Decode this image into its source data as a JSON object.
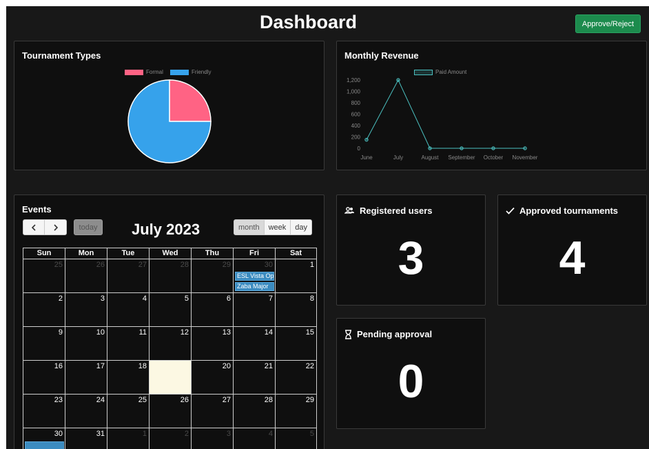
{
  "header": {
    "title": "Dashboard",
    "approve_label": "Approve/Reject"
  },
  "tournament_types": {
    "title": "Tournament Types",
    "legend": [
      {
        "label": "Formal",
        "color": "#ff6384"
      },
      {
        "label": "Friendly",
        "color": "#36a2eb"
      }
    ]
  },
  "monthly_revenue": {
    "title": "Monthly Revenue",
    "legend_label": "Paid Amount"
  },
  "chart_data": [
    {
      "type": "pie",
      "labels": [
        "Formal",
        "Friendly"
      ],
      "values": [
        1,
        3
      ],
      "colors": [
        "#ff6384",
        "#36a2eb"
      ],
      "legend": "top"
    },
    {
      "type": "line",
      "x": [
        "June",
        "July",
        "August",
        "September",
        "October",
        "November"
      ],
      "series": [
        {
          "name": "Paid Amount",
          "values": [
            150,
            1200,
            0,
            0,
            0,
            0
          ],
          "color": "#4bc0c0"
        }
      ],
      "ylim": [
        0,
        1200
      ],
      "yticks": [
        "1,200",
        "1,000",
        "800",
        "600",
        "400",
        "200",
        "0"
      ],
      "legend": "top"
    }
  ],
  "events": {
    "title": "Events",
    "today_label": "today",
    "month_title": "July 2023",
    "views": [
      "month",
      "week",
      "day"
    ],
    "weekdays": [
      "Sun",
      "Mon",
      "Tue",
      "Wed",
      "Thu",
      "Fri",
      "Sat"
    ],
    "weeks": [
      [
        {
          "d": "25",
          "o": true
        },
        {
          "d": "26",
          "o": true
        },
        {
          "d": "27",
          "o": true
        },
        {
          "d": "28",
          "o": true
        },
        {
          "d": "29",
          "o": true
        },
        {
          "d": "30",
          "o": true
        },
        {
          "d": "1"
        }
      ],
      [
        {
          "d": "2"
        },
        {
          "d": "3"
        },
        {
          "d": "4"
        },
        {
          "d": "5"
        },
        {
          "d": "6"
        },
        {
          "d": "7"
        },
        {
          "d": "8"
        }
      ],
      [
        {
          "d": "9"
        },
        {
          "d": "10"
        },
        {
          "d": "11"
        },
        {
          "d": "12"
        },
        {
          "d": "13"
        },
        {
          "d": "14"
        },
        {
          "d": "15"
        }
      ],
      [
        {
          "d": "16"
        },
        {
          "d": "17"
        },
        {
          "d": "18"
        },
        {
          "d": "19",
          "t": true
        },
        {
          "d": "20"
        },
        {
          "d": "21"
        },
        {
          "d": "22"
        }
      ],
      [
        {
          "d": "23"
        },
        {
          "d": "24"
        },
        {
          "d": "25"
        },
        {
          "d": "26"
        },
        {
          "d": "27"
        },
        {
          "d": "28"
        },
        {
          "d": "29"
        }
      ],
      [
        {
          "d": "30"
        },
        {
          "d": "31"
        },
        {
          "d": "1",
          "o": true
        },
        {
          "d": "2",
          "o": true
        },
        {
          "d": "3",
          "o": true
        },
        {
          "d": "4",
          "o": true
        },
        {
          "d": "5",
          "o": true
        }
      ]
    ],
    "calendar_events": [
      "ESL Vista Op",
      "Zaba Major"
    ]
  },
  "stats": {
    "registered_users": {
      "label": "Registered users",
      "value": "3"
    },
    "approved_tournaments": {
      "label": "Approved tournaments",
      "value": "4"
    },
    "pending_approval": {
      "label": "Pending approval",
      "value": "0"
    }
  }
}
